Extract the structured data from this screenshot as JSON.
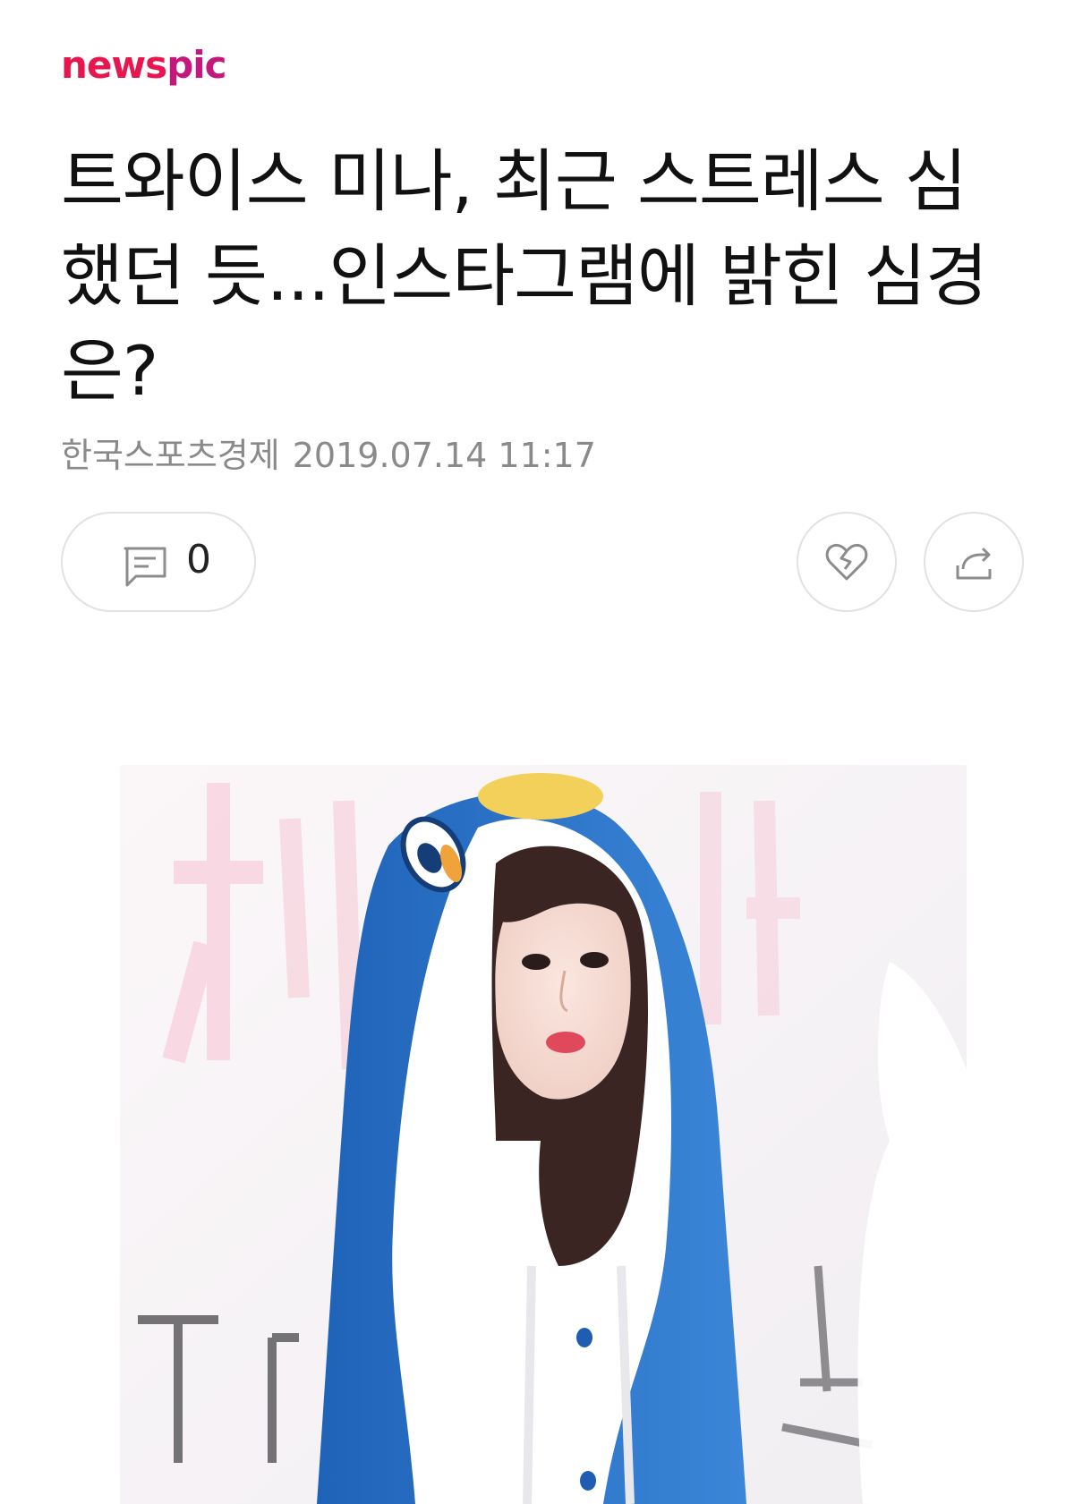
{
  "brand": {
    "logo_part1": "news",
    "logo_part2": "pic",
    "logo_color_primary": "#e8164f",
    "logo_color_secondary": "#c4187d"
  },
  "article": {
    "headline": "트와이스 미나, 최근 스트레스 심했던 듯...인스타그램에 밝힌 심경은?",
    "source": "한국스포츠경제",
    "datetime": "2019.07.14 11:17"
  },
  "actions": {
    "comment_icon": "comment-icon",
    "comment_count": "0",
    "like_icon": "heart-icon",
    "share_icon": "share-icon"
  },
  "photo": {
    "description_icon": "article-photo"
  }
}
